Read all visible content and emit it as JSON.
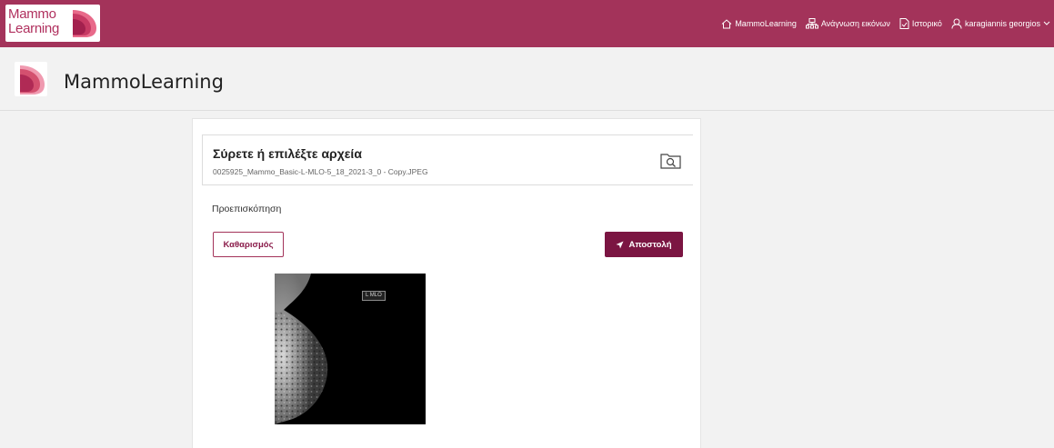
{
  "app": {
    "logo_line1": "Mammo",
    "logo_line2": "Learning",
    "brand_color": "#a3335a",
    "accent_dark": "#7b1542"
  },
  "nav": {
    "items": [
      {
        "label": "MammoLearning",
        "icon": "home-icon"
      },
      {
        "label": "Ανάγνωση εικόνων",
        "icon": "network-icon"
      },
      {
        "label": "Ιστορικό",
        "icon": "document-icon"
      },
      {
        "label": "karagiannis georgios",
        "icon": "user-icon"
      }
    ]
  },
  "header": {
    "title": "MammoLearning"
  },
  "upload": {
    "title": "Σύρετε ή επιλέξτε αρχεία",
    "filename": "0025925_Mammo_Basic-L-MLO-5_18_2021-3_0 - Copy.JPEG",
    "icon": "folder-search-icon"
  },
  "preview": {
    "label": "Προεπισκόπηση",
    "image_tag": "L MLO"
  },
  "actions": {
    "clear_label": "Καθαρισμός",
    "send_label": "Αποστολή"
  }
}
